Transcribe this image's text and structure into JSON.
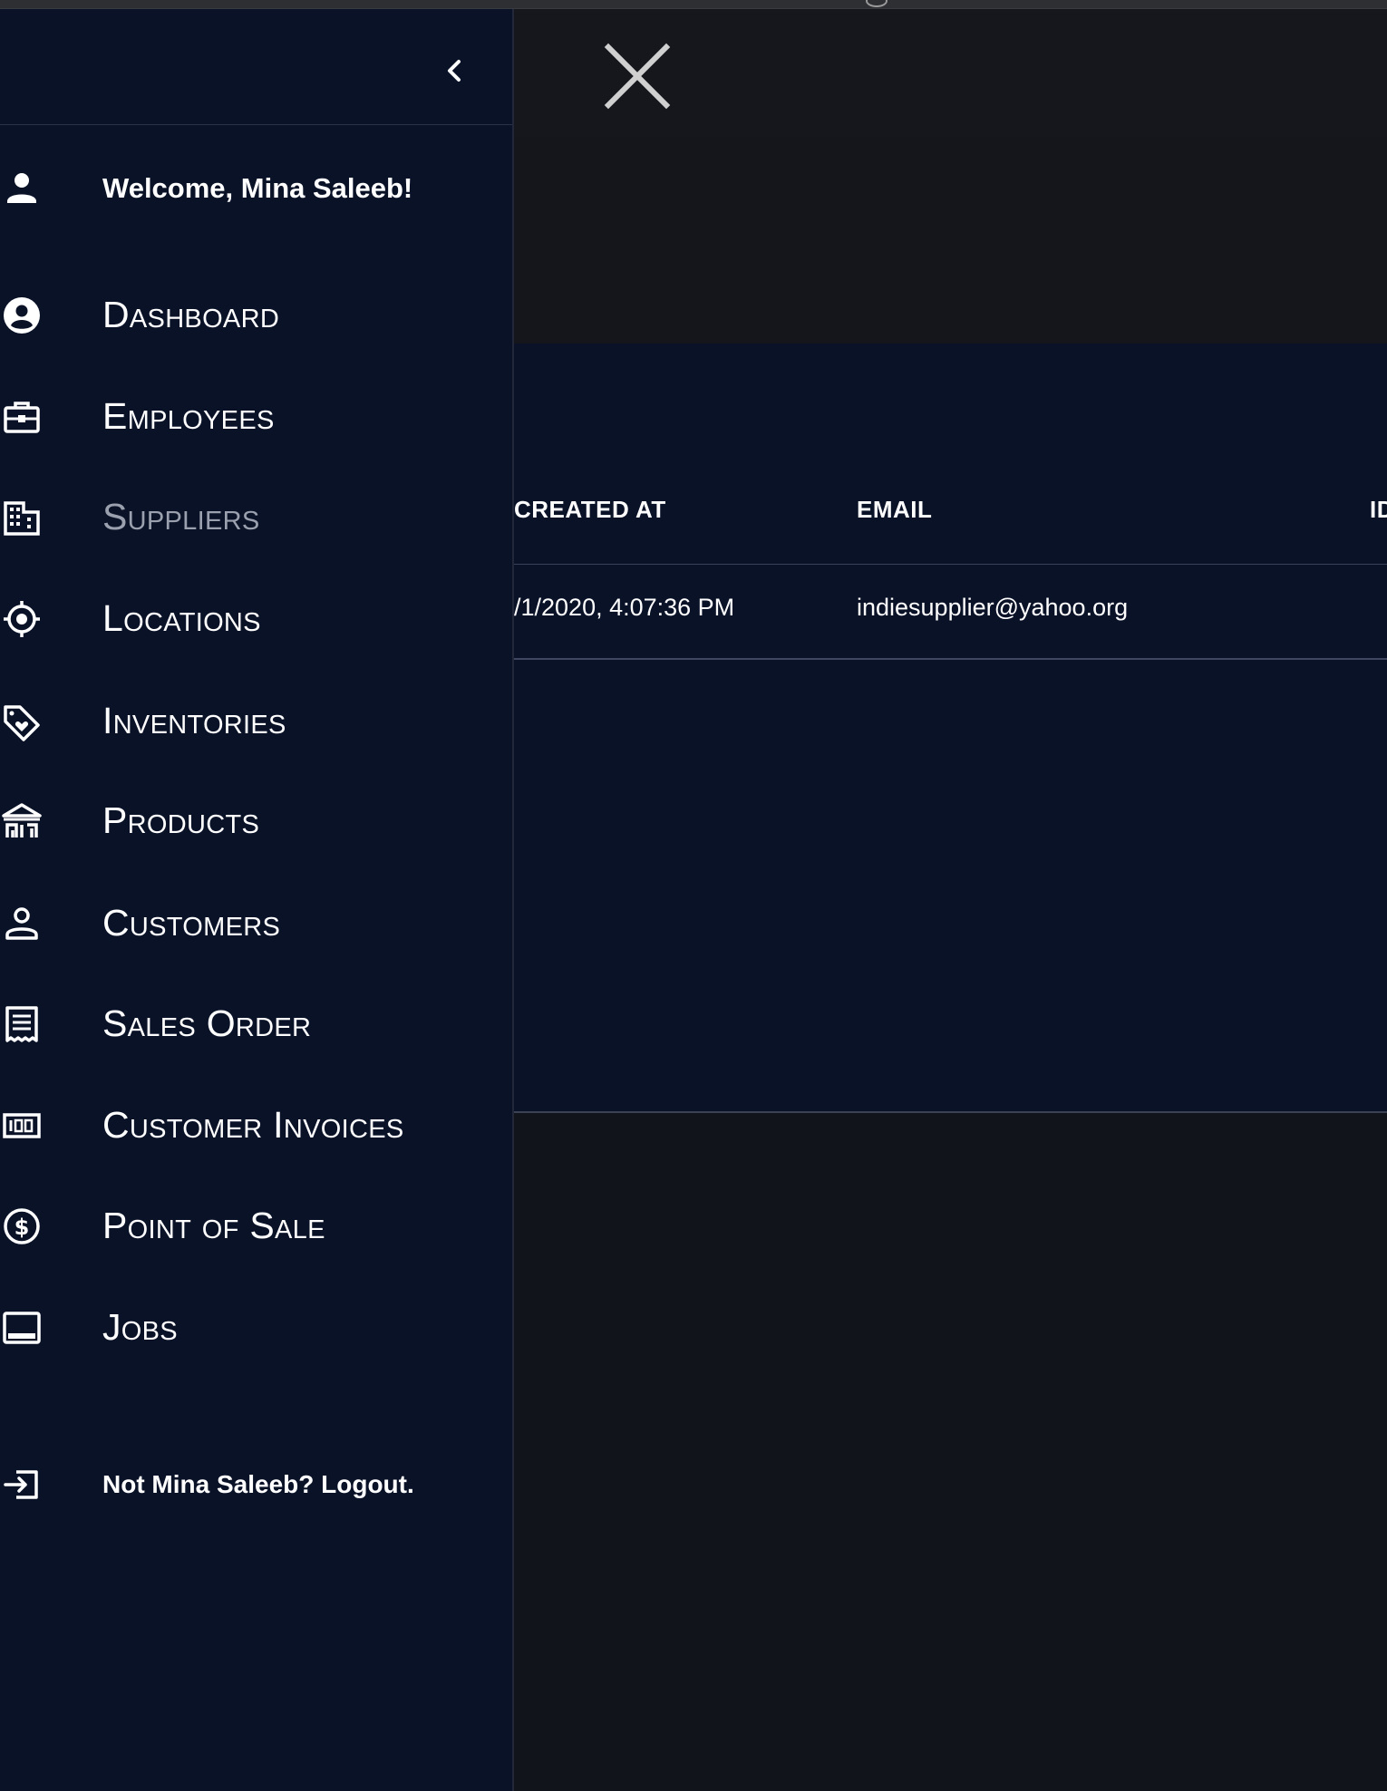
{
  "drawer": {
    "welcome": "Welcome, Mina Saleeb!",
    "items": [
      {
        "label": "Dashboard",
        "icon": "account-circle-icon"
      },
      {
        "label": "Employees",
        "icon": "briefcase-icon"
      },
      {
        "label": "Suppliers",
        "icon": "building-icon",
        "active": true
      },
      {
        "label": "Locations",
        "icon": "crosshair-icon"
      },
      {
        "label": "Inventories",
        "icon": "tag-heart-icon"
      },
      {
        "label": "Products",
        "icon": "store-icon"
      },
      {
        "label": "Customers",
        "icon": "person-outline-icon"
      },
      {
        "label": "Sales Order",
        "icon": "receipt-icon"
      },
      {
        "label": "Customer Invoices",
        "icon": "invoice-icon"
      },
      {
        "label": "Point of Sale",
        "icon": "dollar-circle-icon"
      },
      {
        "label": "Jobs",
        "icon": "monitor-icon"
      }
    ],
    "logout": "Not Mina Saleeb? Logout."
  },
  "table": {
    "columns": {
      "created_at": "CREATED AT",
      "email": "EMAIL",
      "id": "ID"
    },
    "rows": [
      {
        "created_at": "/1/2020, 4:07:36 PM",
        "email": "indiesupplier@yahoo.org"
      }
    ]
  },
  "colors": {
    "drawer_bg": "#0a1228",
    "page_bg": "#12141c",
    "text": "#ffffff",
    "disabled_text": "#9aa0ad"
  }
}
